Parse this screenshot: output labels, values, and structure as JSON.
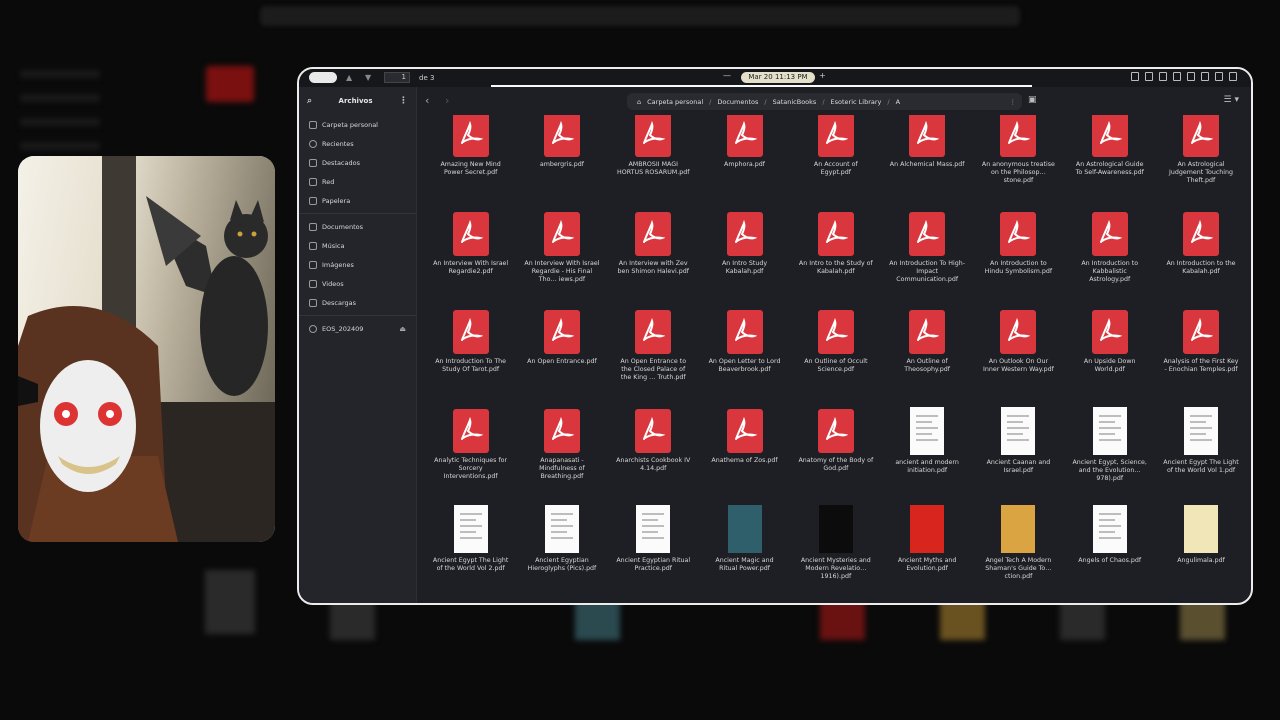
{
  "topbar": {
    "page": "1",
    "of": "de 3",
    "clock": "Mar 20  11:13 PM"
  },
  "sidebar": {
    "title": "Archivos",
    "items": [
      {
        "label": "Carpeta personal"
      },
      {
        "label": "Recientes"
      },
      {
        "label": "Destacados"
      },
      {
        "label": "Red"
      },
      {
        "label": "Papelera"
      }
    ],
    "places": [
      {
        "label": "Documentos"
      },
      {
        "label": "Música"
      },
      {
        "label": "Imágenes"
      },
      {
        "label": "Videos"
      },
      {
        "label": "Descargas"
      }
    ],
    "devices": [
      {
        "label": "EOS_202409"
      }
    ]
  },
  "breadcrumb": [
    "Carpeta personal",
    "Documentos",
    "SatanicBooks",
    "Esoteric Library",
    "A"
  ],
  "files": [
    {
      "name": "Amazing New Mind Power Secret.pdf",
      "kind": "pdf"
    },
    {
      "name": "ambergris.pdf",
      "kind": "pdf"
    },
    {
      "name": "AMBROSII MAGI HORTUS ROSARUM.pdf",
      "kind": "pdf"
    },
    {
      "name": "Amphora.pdf",
      "kind": "pdf"
    },
    {
      "name": "An Account of Egypt.pdf",
      "kind": "pdf"
    },
    {
      "name": "An Alchemical Mass.pdf",
      "kind": "pdf"
    },
    {
      "name": "An anonymous treatise on the Philosop… stone.pdf",
      "kind": "pdf"
    },
    {
      "name": "An Astrological Guide To Self-Awareness.pdf",
      "kind": "pdf"
    },
    {
      "name": "An Astrological Judgement Touching Theft.pdf",
      "kind": "pdf"
    },
    {
      "name": "An Interview With Israel Regardie2.pdf",
      "kind": "pdf"
    },
    {
      "name": "An Interview With Israel Regardie - His Final Tho… iews.pdf",
      "kind": "pdf"
    },
    {
      "name": "An Interview with Zev ben Shimon Halevi.pdf",
      "kind": "pdf"
    },
    {
      "name": "An Intro Study Kabalah.pdf",
      "kind": "pdf"
    },
    {
      "name": "An Intro to the Study of Kabalah.pdf",
      "kind": "pdf"
    },
    {
      "name": "An Introduction To High-Impact Communication.pdf",
      "kind": "pdf"
    },
    {
      "name": "An Introduction to Hindu Symbolism.pdf",
      "kind": "pdf"
    },
    {
      "name": "An Introduction to Kabbalistic Astrology.pdf",
      "kind": "pdf"
    },
    {
      "name": "An Introduction to the Kabalah.pdf",
      "kind": "pdf"
    },
    {
      "name": "An Introduction To The Study Of Tarot.pdf",
      "kind": "pdf"
    },
    {
      "name": "An Open Entrance.pdf",
      "kind": "pdf"
    },
    {
      "name": "An Open Entrance to the Closed Palace of the King … Truth.pdf",
      "kind": "pdf"
    },
    {
      "name": "An Open Letter to Lord Beaverbrook.pdf",
      "kind": "pdf"
    },
    {
      "name": "An Outline of Occult Science.pdf",
      "kind": "pdf"
    },
    {
      "name": "An Outline of Theosophy.pdf",
      "kind": "pdf"
    },
    {
      "name": "An Outlook On Our Inner Western Way.pdf",
      "kind": "pdf"
    },
    {
      "name": "An Upside Down World.pdf",
      "kind": "pdf"
    },
    {
      "name": "Analysis of the First Key - Enochian Temples.pdf",
      "kind": "pdf"
    },
    {
      "name": "Analytic Techniques for Sorcery Interventions.pdf",
      "kind": "pdf"
    },
    {
      "name": "Anapanasati - Mindfulness of Breathing.pdf",
      "kind": "pdf"
    },
    {
      "name": "Anarchists Cookbook IV 4.14.pdf",
      "kind": "pdf"
    },
    {
      "name": "Anathema of Zos.pdf",
      "kind": "pdf"
    },
    {
      "name": "Anatomy of the Body of God.pdf",
      "kind": "pdf"
    },
    {
      "name": "ancient and modern initiation.pdf",
      "kind": "doc"
    },
    {
      "name": "Ancient Caanan and Israel.pdf",
      "kind": "doc"
    },
    {
      "name": "Ancient Egypt, Science, and the Evolution… 978).pdf",
      "kind": "doc"
    },
    {
      "name": "Ancient Egypt The Light of the World Vol 1.pdf",
      "kind": "doc"
    },
    {
      "name": "Ancient Egypt The Light of the World Vol 2.pdf",
      "kind": "doc"
    },
    {
      "name": "Ancient Egyptian Hieroglyphs (Pics).pdf",
      "kind": "doc"
    },
    {
      "name": "Ancient Egyptian Ritual Practice.pdf",
      "kind": "doc"
    },
    {
      "name": "Ancient Magic and Ritual Power.pdf",
      "kind": "cover",
      "color": "#2f5f6b"
    },
    {
      "name": "Ancient Mysteries and Modern Revelatio… 1916).pdf",
      "kind": "cover",
      "color": "#0c0c0c"
    },
    {
      "name": "Ancient Myths and Evolution.pdf",
      "kind": "cover",
      "color": "#d8251d"
    },
    {
      "name": "Angel Tech A Modern Shaman's Guide To… ction.pdf",
      "kind": "cover",
      "color": "#d9a441"
    },
    {
      "name": "Angels of Chaos.pdf",
      "kind": "doc"
    },
    {
      "name": "Angulimala.pdf",
      "kind": "cover",
      "color": "#f1e6b8"
    },
    {
      "name": "",
      "kind": "doc"
    },
    {
      "name": "",
      "kind": "cover",
      "color": "#e8d79a"
    },
    {
      "name": "",
      "kind": "doc"
    },
    {
      "name": "",
      "kind": "cover",
      "color": "#141414"
    },
    {
      "name": "",
      "kind": "doc"
    },
    {
      "name": "",
      "kind": "doc"
    },
    {
      "name": "",
      "kind": "doc"
    },
    {
      "name": "",
      "kind": "cover",
      "color": "#1a1a1a"
    },
    {
      "name": "",
      "kind": "cover",
      "color": "#2e8fe0"
    }
  ]
}
